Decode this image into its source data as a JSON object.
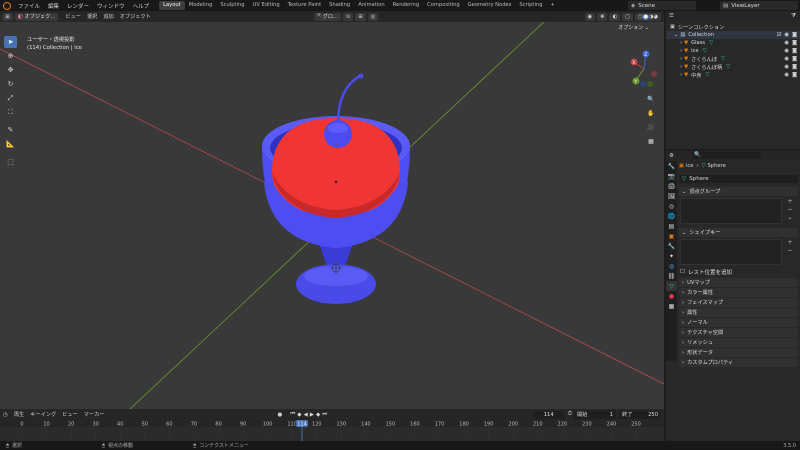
{
  "topbar": {
    "menus": [
      "ファイル",
      "編集",
      "レンダー",
      "ウィンドウ",
      "ヘルプ"
    ],
    "workspace_tabs": [
      "Layout",
      "Modeling",
      "Sculpting",
      "UV Editing",
      "Texture Paint",
      "Shading",
      "Animation",
      "Rendering",
      "Compositing",
      "Geometry Nodes",
      "Scripting"
    ],
    "active_tab": "Layout",
    "add_tab": "+",
    "scene": "Scene",
    "view_layer": "ViewLayer"
  },
  "header3d": {
    "mode": "オブジェク...",
    "menus": [
      "ビュー",
      "選択",
      "追加",
      "オブジェクト"
    ],
    "transform_orientation": "グロ...",
    "options": "オプション"
  },
  "viewport": {
    "view_name": "ユーザー・透視投影",
    "collection_info": "(114) Collection | ice"
  },
  "gizmo": {
    "x": "X",
    "y": "Y",
    "z": "Z"
  },
  "colors": {
    "glass": "#5252f5",
    "glass_dark": "#3b3bd6",
    "cherry_red": "#f03535",
    "accent_blue": "#4772b3",
    "x_axis": "#c0444a",
    "y_axis": "#6a9a2a",
    "orange": "#e87d0d"
  },
  "timeline": {
    "menus": [
      "再生",
      "キーイング",
      "ビュー",
      "マーカー"
    ],
    "current_frame": "114",
    "start_label": "開始",
    "start_value": "1",
    "end_label": "終了",
    "end_value": "250",
    "ticks": [
      "0",
      "10",
      "20",
      "30",
      "40",
      "50",
      "60",
      "70",
      "80",
      "90",
      "100",
      "110",
      "120",
      "130",
      "140",
      "150",
      "160",
      "170",
      "180",
      "190",
      "200",
      "210",
      "220",
      "230",
      "240",
      "250"
    ],
    "playhead": "114"
  },
  "statusbar": {
    "select": "選択",
    "rotate_view": "視点の移動",
    "context_menu": "コンテクストメニュー",
    "version": "3.5.0"
  },
  "outliner": {
    "title": "シーンコレクション",
    "collection": "Collection",
    "items": [
      "Glass",
      "ice",
      "さくらんぼ",
      "さくらんぼ柄",
      "中身"
    ]
  },
  "properties": {
    "breadcrumb_object": "ice",
    "breadcrumb_mesh": "Sphere",
    "mesh_name": "Sphere",
    "vertex_groups": "頂点グループ",
    "shape_keys": "シェイプキー",
    "relative_label": "レスト位置を追加",
    "sections": [
      "UVマップ",
      "カラー属性",
      "フェイスマップ",
      "属性",
      "ノーマル",
      "テクスチャ空間",
      "リメッシュ",
      "形状データ",
      "カスタムプロパティ"
    ]
  }
}
